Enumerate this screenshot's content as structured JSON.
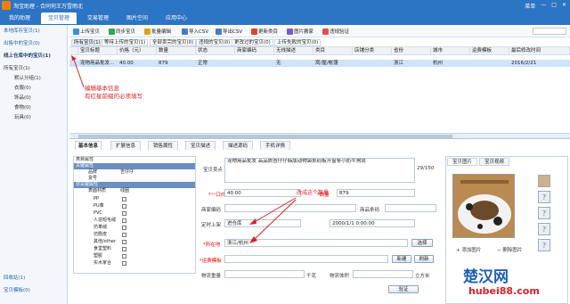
{
  "app": {
    "title": "淘宝助理 - 合同何王万雪雨北",
    "window_controls": [
      "菜单",
      "—",
      "□",
      "✕"
    ]
  },
  "nav": {
    "tabs": [
      "我的助理",
      "宝贝管理",
      "交易管理",
      "图片空间",
      "应用中心"
    ],
    "active_index": 1
  },
  "sidebar": {
    "items": [
      "本地库存宝贝(1)",
      "出售中的宝贝(0)",
      "线上仓库中的宝贝(1)"
    ],
    "tree_root": "所有宝贝(1)",
    "tree_children": [
      "默认分组(1)",
      "衣服(0)",
      "饰品(0)",
      "食物(0)",
      "玩具(0)"
    ],
    "bottom_items": [
      "回收站(1)",
      "宝贝模板(0)"
    ]
  },
  "toolbar": {
    "buttons": [
      "上传宝贝",
      "同步宝贝",
      "批量编辑",
      "导入CSV",
      "导出CSV",
      "更新类目",
      "图片搬家",
      "违规验证"
    ]
  },
  "filters": {
    "tabs": [
      "所有宝贝(1)",
      "等待上传的宝贝(1)",
      "全部卖完的宝贝(0)",
      "违规的宝贝(0)",
      "更改过的宝贝(0)",
      "上传失败的宝贝(0)"
    ],
    "active_index": 0
  },
  "table": {
    "columns": [
      "宝贝标题",
      "价格（元）",
      "数量",
      "状态",
      "商家编码",
      "无线描述",
      "类目",
      "店铺分类",
      "省份",
      "城市",
      "运费模板",
      "最后修改时间"
    ],
    "row": [
      "宠物用品批发...",
      "40.00",
      "879",
      "正常",
      "",
      "无",
      "窝/屋/帐篷",
      "",
      "浙江",
      "杭州",
      "",
      "2016/2/21"
    ]
  },
  "annotations": {
    "note1": "编辑基本信息\n有红星前缀的必须填写",
    "note2": "改成这个数量"
  },
  "editor": {
    "tabs": [
      "基本信息",
      "扩展信息",
      "销售属性",
      "宝贝描述",
      "描述源码",
      "手机详情"
    ],
    "active_tab": 0,
    "attr_title": "类目属性",
    "attr_sections": [
      {
        "name": "关键属性",
        "rows": [
          {
            "k": "品牌",
            "v": "吉仔仔"
          },
          {
            "k": "货号",
            "v": ""
          }
        ]
      },
      {
        "name": "非关键属性",
        "rows": [
          {
            "k": "表面材质",
            "v": "线圈"
          },
          {
            "k": "PP",
            "v": ""
          },
          {
            "k": "PU革",
            "v": ""
          },
          {
            "k": "PVC",
            "v": ""
          },
          {
            "k": "人造短毛绒",
            "v": ""
          },
          {
            "k": "仿革绒",
            "v": ""
          },
          {
            "k": "仿麂皮",
            "v": ""
          },
          {
            "k": "其他/other",
            "v": ""
          },
          {
            "k": "食堂塑料",
            "v": ""
          },
          {
            "k": "塑胶",
            "v": ""
          },
          {
            "k": "实木家合",
            "v": ""
          }
        ]
      }
    ],
    "fields": {
      "title_label": "宝贝卖点",
      "title_value": "宠物用品批发 高品质吉仔仔韩版动物袋抓码板开窗条小奶牛狗窝",
      "title_counter": "29/150",
      "price_label": "*一口价",
      "price_value": "40.00",
      "qty_label": "*数量",
      "qty_value": "879",
      "code_label": "商家编码",
      "code_value": "",
      "barcode_label": "商品条码",
      "barcode_value": "",
      "ontime_label": "定时上架",
      "ontime_value": "进仓库",
      "ontime_date": "2000/1/1 0:00:00",
      "location_label": "*所在地",
      "location_value": "浙江/杭州",
      "location_btn": "选择",
      "shipping_label": "*运费模板",
      "shipping_btn1": "新建",
      "shipping_btn2": "刷新",
      "weight_label": "物流重量",
      "weight_unit": "千克",
      "volume_label": "物流体积",
      "volume_unit": "立方米",
      "verify_btn": "验证"
    },
    "image_tabs": [
      "宝贝图片",
      "宝贝视频"
    ],
    "image_actions": [
      "添加图片",
      "删除图片"
    ]
  },
  "watermark": {
    "line1": "楚汉网",
    "line2": "hubei88.com"
  }
}
